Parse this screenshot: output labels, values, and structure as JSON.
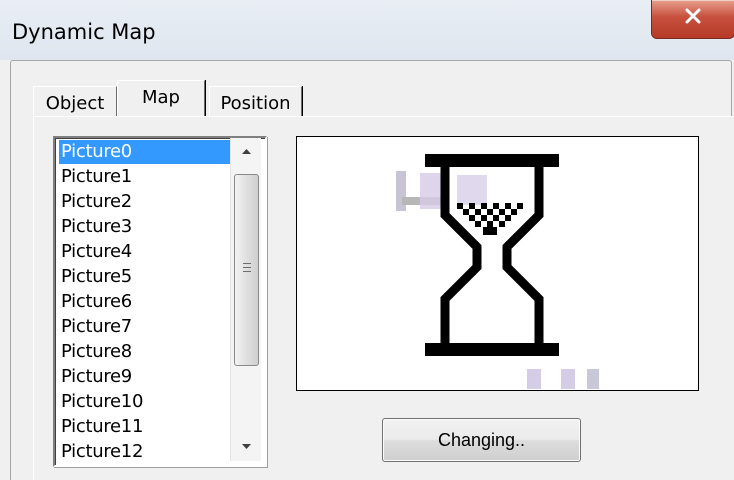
{
  "window": {
    "title": "Dynamic Map"
  },
  "tabs": [
    {
      "label": "Object",
      "active": false
    },
    {
      "label": "Map",
      "active": true
    },
    {
      "label": "Position",
      "active": false
    }
  ],
  "picture_list": {
    "selected": "Picture0",
    "items": [
      "Picture0",
      "Picture1",
      "Picture2",
      "Picture3",
      "Picture4",
      "Picture5",
      "Picture6",
      "Picture7",
      "Picture8",
      "Picture9",
      "Picture10",
      "Picture11",
      "Picture12"
    ]
  },
  "preview": {
    "icon": "hourglass-icon"
  },
  "buttons": {
    "changing_label": "Changing.."
  },
  "colors": {
    "selection": "#3399ff",
    "close_button": "#c7503d"
  }
}
